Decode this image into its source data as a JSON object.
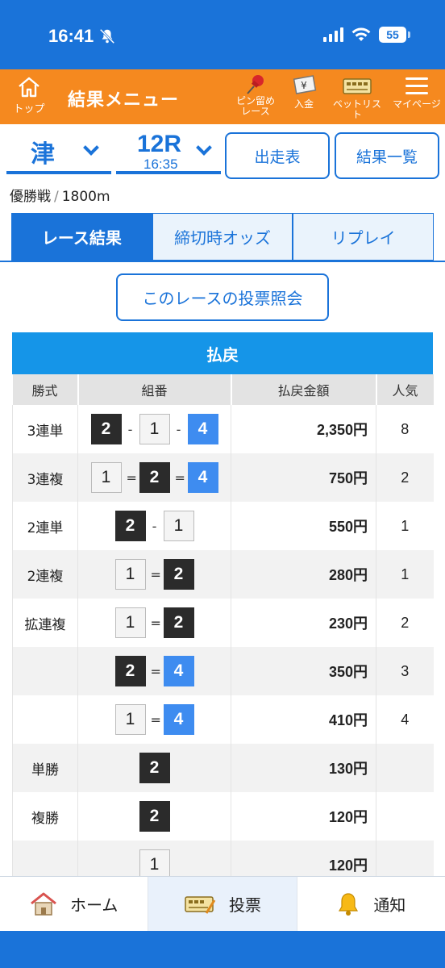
{
  "status": {
    "time": "16:41",
    "battery": "55"
  },
  "header": {
    "top_label": "トップ",
    "title": "結果メニュー",
    "pin_label_1": "ピン留め",
    "pin_label_2": "レース",
    "deposit_label": "入金",
    "betlist_label": "ベットリスト",
    "mypage_label": "マイページ"
  },
  "selector": {
    "venue": "津",
    "race": "12R",
    "race_time": "16:35",
    "entries_button": "出走表",
    "results_list_button": "結果一覧"
  },
  "race_info": {
    "name": "優勝戦",
    "separator": "/",
    "distance": "1800m"
  },
  "tabs": [
    {
      "label": "レース結果",
      "active": true
    },
    {
      "label": "締切時オッズ",
      "active": false
    },
    {
      "label": "リプレイ",
      "active": false
    }
  ],
  "inquiry_button": "このレースの投票照会",
  "payout": {
    "title": "払戻",
    "columns": [
      "勝式",
      "組番",
      "払戻金額",
      "人気"
    ],
    "rows": [
      {
        "type": "3連単",
        "combo": [
          "2",
          "-",
          "1",
          "-",
          "4"
        ],
        "amount": "2,350円",
        "popularity": "8"
      },
      {
        "type": "3連複",
        "combo": [
          "1",
          "=",
          "2",
          "=",
          "4"
        ],
        "amount": "750円",
        "popularity": "2"
      },
      {
        "type": "2連単",
        "combo": [
          "2",
          "-",
          "1"
        ],
        "amount": "550円",
        "popularity": "1"
      },
      {
        "type": "2連複",
        "combo": [
          "1",
          "=",
          "2"
        ],
        "amount": "280円",
        "popularity": "1"
      },
      {
        "type": "拡連複",
        "combo": [
          "1",
          "=",
          "2"
        ],
        "amount": "230円",
        "popularity": "2"
      },
      {
        "type": "",
        "combo": [
          "2",
          "=",
          "4"
        ],
        "amount": "350円",
        "popularity": "3"
      },
      {
        "type": "",
        "combo": [
          "1",
          "=",
          "4"
        ],
        "amount": "410円",
        "popularity": "4"
      },
      {
        "type": "単勝",
        "combo": [
          "2"
        ],
        "amount": "130円",
        "popularity": ""
      },
      {
        "type": "複勝",
        "combo": [
          "2"
        ],
        "amount": "120円",
        "popularity": ""
      },
      {
        "type": "",
        "combo": [
          "1"
        ],
        "amount": "120円",
        "popularity": ""
      }
    ]
  },
  "bottom_nav": [
    {
      "label": "ホーム",
      "icon": "house-icon",
      "active": false
    },
    {
      "label": "投票",
      "icon": "ticket-icon",
      "active": true
    },
    {
      "label": "通知",
      "icon": "bell-icon",
      "active": false
    }
  ],
  "colors": {
    "primary": "#1a73d9",
    "header": "#f5891f",
    "payout_head": "#1595e8",
    "boat1": "#f4f4f4",
    "boat2": "#2b2b2b",
    "boat4": "#3e8cf0"
  }
}
